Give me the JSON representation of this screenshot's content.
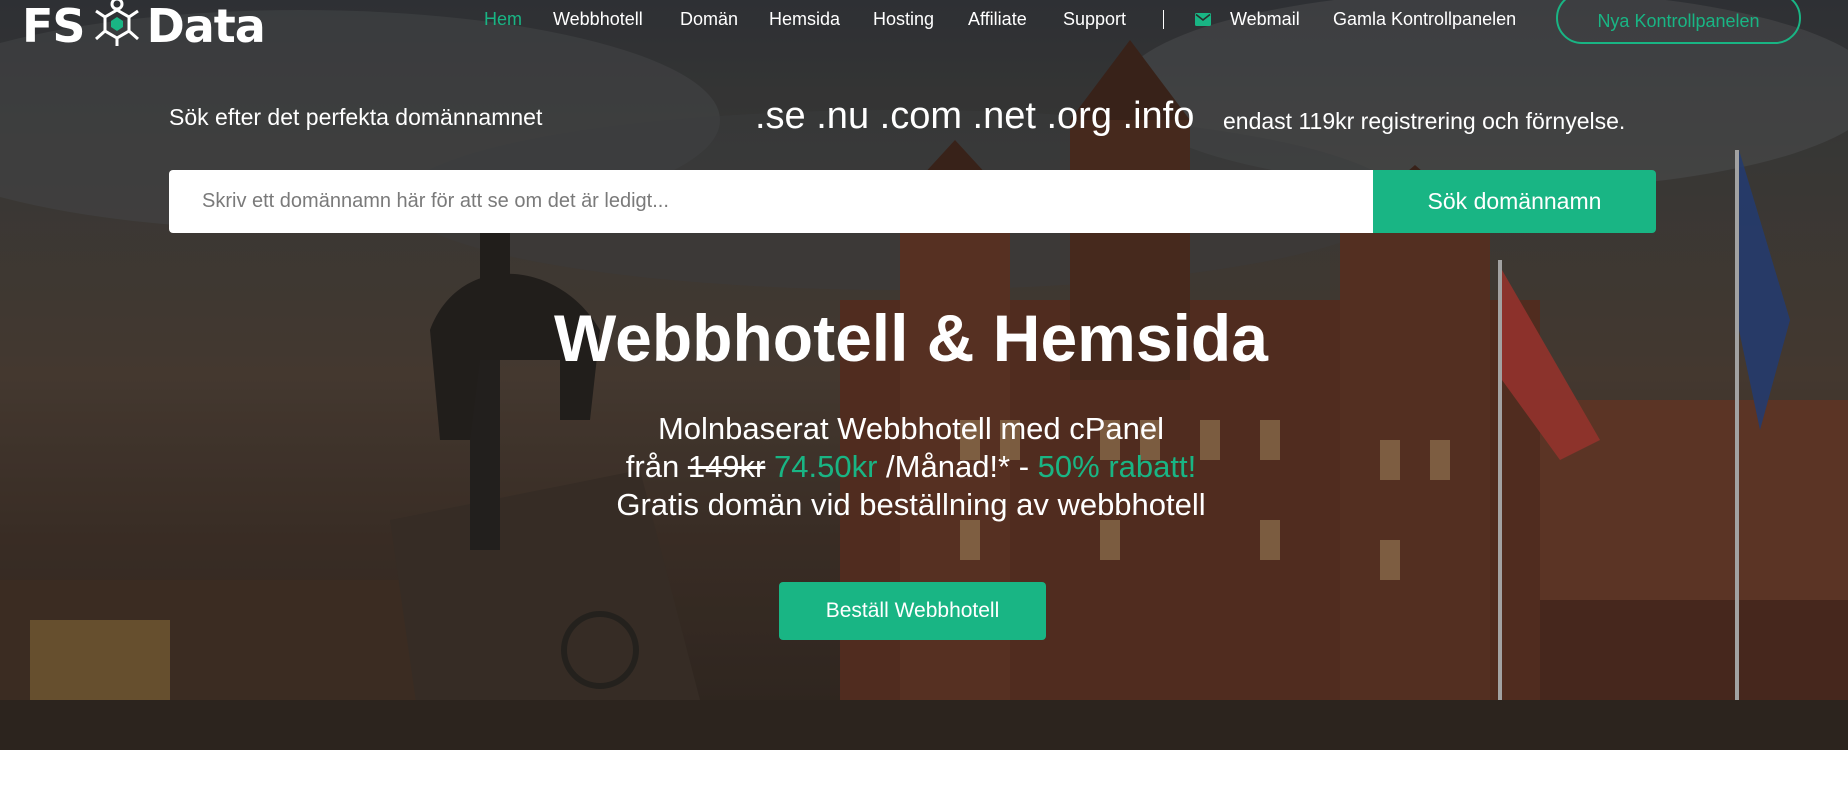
{
  "brand": {
    "logo_left": "FS",
    "logo_right": "Data",
    "accent": "#19b584"
  },
  "nav": {
    "items": [
      {
        "label": "Hem",
        "active": true
      },
      {
        "label": "Webbhotell"
      },
      {
        "label": "Domän"
      },
      {
        "label": "Hemsida"
      },
      {
        "label": "Hosting"
      },
      {
        "label": "Affiliate"
      },
      {
        "label": "Support"
      }
    ],
    "webmail": {
      "label": "Webmail",
      "icon": "envelope-icon"
    },
    "old_panel": "Gamla Kontrollpanelen",
    "new_panel": "Nya Kontrollpanelen"
  },
  "domain_search": {
    "label": "Sök efter det perfekta domännamnet",
    "tlds": ".se .nu .com .net .org .info",
    "tld_note": "endast 119kr registrering och förnyelse.",
    "placeholder": "Skriv ett domännamn här för att se om det är ledigt...",
    "button": "Sök domännamn"
  },
  "hero": {
    "headline": "Webbhotell & Hemsida",
    "line1": "Molnbaserat Webbhotell med cPanel",
    "line2_prefix": "från",
    "old_price": "149kr",
    "new_price": "74.50kr",
    "per_month": "/Månad!* -",
    "discount": "50% rabatt!",
    "line3": "Gratis domän vid beställning av webbhotell",
    "cta": "Beställ Webbhotell"
  }
}
